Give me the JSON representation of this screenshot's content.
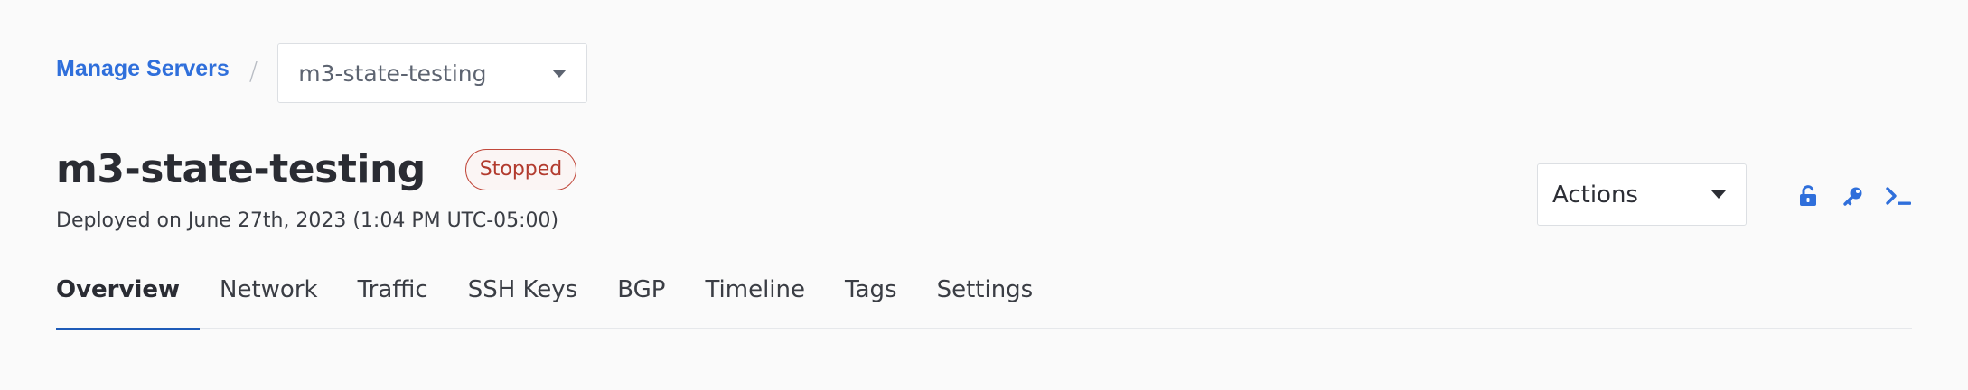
{
  "breadcrumb": {
    "parent_label": "Manage Servers",
    "separator": "/",
    "server_select_value": "m3-state-testing"
  },
  "header": {
    "title": "m3-state-testing",
    "status": "Stopped",
    "deployed_text": "Deployed on June 27th, 2023 (1:04 PM UTC-05:00)"
  },
  "actions": {
    "select_label": "Actions",
    "icons": [
      "unlock-icon",
      "key-icon",
      "terminal-icon"
    ]
  },
  "tabs": [
    {
      "label": "Overview",
      "active": true
    },
    {
      "label": "Network"
    },
    {
      "label": "Traffic"
    },
    {
      "label": "SSH Keys"
    },
    {
      "label": "BGP"
    },
    {
      "label": "Timeline"
    },
    {
      "label": "Tags"
    },
    {
      "label": "Settings"
    }
  ],
  "colors": {
    "accent": "#2f6fdb",
    "status_stopped": "#c1483b",
    "tab_underline": "#1e5bb8"
  }
}
